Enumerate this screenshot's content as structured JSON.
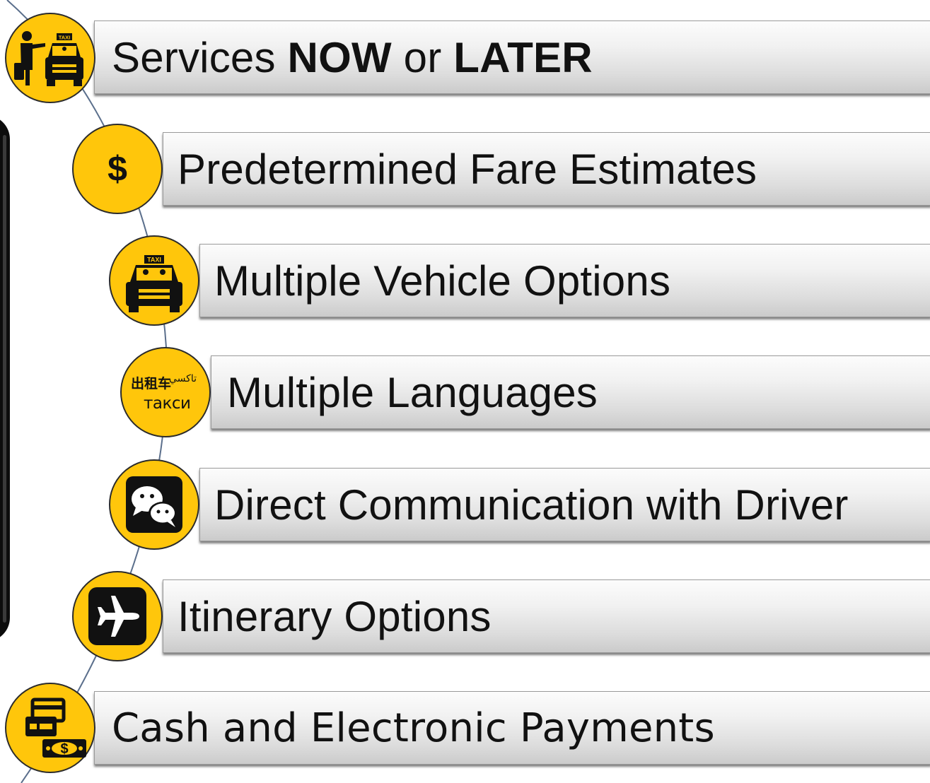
{
  "features": [
    {
      "parts": [
        {
          "text": "Services ",
          "bold": false
        },
        {
          "text": "NOW",
          "bold": true
        },
        {
          "text": " or ",
          "bold": false
        },
        {
          "text": "LATER",
          "bold": true
        }
      ],
      "icon": "passenger-taxi-icon"
    },
    {
      "parts": [
        {
          "text": "Predetermined Fare Estimates",
          "bold": false
        }
      ],
      "icon": "dollar-icon"
    },
    {
      "parts": [
        {
          "text": "Multiple Vehicle Options",
          "bold": false
        }
      ],
      "icon": "taxi-icon"
    },
    {
      "parts": [
        {
          "text": "Multiple Languages",
          "bold": false
        }
      ],
      "icon": "languages-icon"
    },
    {
      "parts": [
        {
          "text": "Direct Communication with Driver",
          "bold": false
        }
      ],
      "icon": "chat-icon"
    },
    {
      "parts": [
        {
          "text": "Itinerary Options",
          "bold": false
        }
      ],
      "icon": "airplane-icon"
    },
    {
      "parts": [
        {
          "text": "Cash and Electronic Payments",
          "bold": false
        }
      ],
      "icon": "payment-icon"
    }
  ],
  "icon_text": {
    "taxi_sign": "TAXI",
    "dollar": "$",
    "lang_zh": "出租车",
    "lang_ar": "تاكسي",
    "lang_ru": "такси",
    "bill_mark": "$"
  },
  "colors": {
    "badge": "#ffc60b",
    "bar_top": "#fcfcfc",
    "bar_bottom": "#cbcbcb",
    "icon": "#111111"
  }
}
